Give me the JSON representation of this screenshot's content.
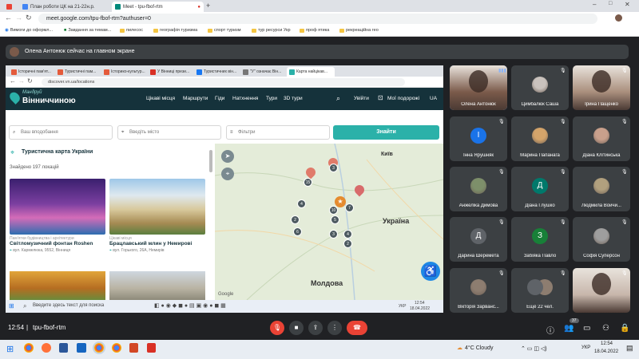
{
  "browser": {
    "tabs": [
      {
        "label": "Gmail",
        "icon": "gmail-icon",
        "color": "#ea4335"
      },
      {
        "label": "План роботи ЦК на 21-22н.р.",
        "icon": "docs-icon",
        "color": "#4285f4"
      },
      {
        "label": "Meet - tpu-fbof-rtm",
        "icon": "meet-icon",
        "color": "#00897b",
        "active": true
      }
    ],
    "url": "meet.google.com/tpu-fbof-rtm?authuser=0",
    "bookmarks": [
      "Вимоги до оформл...",
      "Завдання за темам...",
      "пилесос",
      "географія туризма",
      "спорт туризм",
      "тур ресурси Укр",
      "проф ятика",
      "рекреаційна гео"
    ]
  },
  "meet": {
    "presenting_text": "Олена Антонюк сейчас на главном экране",
    "time": "12:54",
    "separator": "|",
    "meeting_code": "tpu-fbof-rtm",
    "participant_count": "37",
    "participants": [
      {
        "name": "Олена Антонюк",
        "type": "video",
        "color": "#7a5a4a",
        "active": true
      },
      {
        "name": "Цимбалюк Саша",
        "type": "photo",
        "color": "#c9c2bd"
      },
      {
        "name": "Ірина Пащенко",
        "type": "video",
        "color": "#a98e7c"
      },
      {
        "name": "Інна Ярушняк",
        "type": "letter",
        "letter": "І",
        "color": "#1a73e8"
      },
      {
        "name": "Марина Папанага",
        "type": "photo",
        "color": "#d4a46a"
      },
      {
        "name": "Діана Клітинська",
        "type": "photo",
        "color": "#c9a08c"
      },
      {
        "name": "Анжеліка Димова",
        "type": "photo",
        "color": "#7d8f6a"
      },
      {
        "name": "Діана Глушко",
        "type": "letter",
        "letter": "Д",
        "color": "#00796b"
      },
      {
        "name": "Людмила Войчи...",
        "type": "photo",
        "color": "#b1a07e"
      },
      {
        "name": "Дарина Шеремета",
        "type": "letter",
        "letter": "Д",
        "color": "#5f6368"
      },
      {
        "name": "Забіяка Павло",
        "type": "letter",
        "letter": "З",
        "color": "#188038"
      },
      {
        "name": "Софія Суперсон",
        "type": "photo",
        "color": "#9e9e9e"
      },
      {
        "name": "Вікторія Зарванс...",
        "type": "photo",
        "color": "#8d7d70"
      },
      {
        "name": "Ещё 22 чел.",
        "type": "more",
        "color": "#5f6368"
      },
      {
        "name": "",
        "type": "video",
        "color": "#c7b6ab"
      }
    ]
  },
  "shared": {
    "tabs": [
      "Історичні пам'ят...",
      "Туристичні пам...",
      "Історико-культур...",
      "У Вінниці прези...",
      "Туристичних він...",
      "\"У\" означає Він...",
      "Карта найцікав..."
    ],
    "url": "discover.vn.ua/locations",
    "logo_top": "Мандруй",
    "logo_bottom": "Вінниччиною",
    "nav": [
      "Цікаві місця",
      "Маршрути",
      "Гіди",
      "Натхнення",
      "Тури",
      "3D тури"
    ],
    "login": "Увійти",
    "my_trips": "Мої подорожі",
    "lang": "UA",
    "search_placeholder": "Ваш вподобання",
    "city_placeholder": "Введіть місто",
    "filters": "Фільтри",
    "find": "Знайти",
    "map_title": "Туристична карта України",
    "found": "Знайдено 197 локацій",
    "cards": [
      {
        "category": "Пам'ятки будівництва і архітектури",
        "title": "Світломузичний фонтан Roshen",
        "address": "вул. Кармелюка, 9552, Вінниця",
        "color": "#4a2e7c"
      },
      {
        "category": "Цікаві місця",
        "title": "Брацлавський млин у Немирові",
        "address": "вул. Горького, 26А, Немирів",
        "color": "#c8b77a"
      }
    ],
    "map_labels": {
      "kyiv": "Київ",
      "ukraine": "Україна",
      "moldova": "Молдова"
    },
    "clusters": [
      "15",
      "3",
      "4",
      "2",
      "10",
      "7",
      "3",
      "5",
      "6",
      "4",
      "2"
    ],
    "taskbar_search": "Введите здесь текст для поиска",
    "taskbar_time": "12:54",
    "taskbar_date": "18.04.2022",
    "taskbar_lang": "УКР"
  },
  "os": {
    "weather": "4°C Cloudy",
    "lang": "УКР",
    "time": "12:54",
    "date": "18.04.2022"
  }
}
